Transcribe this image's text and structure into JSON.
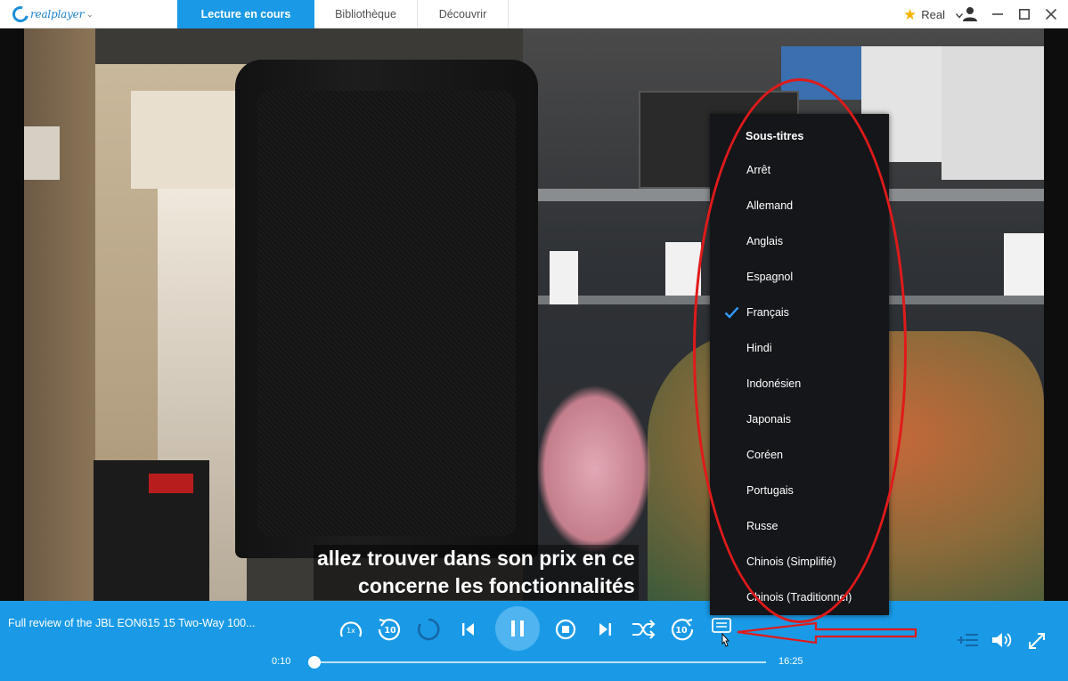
{
  "app": {
    "logo_text": "realplayer",
    "colors": {
      "accent": "#1a9ae6",
      "annotation": "#e01a1a",
      "menu_bg": "#14161a",
      "star": "#f5b400"
    }
  },
  "tabs": [
    {
      "label": "Lecture en cours",
      "active": true
    },
    {
      "label": "Bibliothèque",
      "active": false
    },
    {
      "label": "Découvrir",
      "active": false
    }
  ],
  "titlebar_right": {
    "real_label": "Real",
    "icons": [
      "star-icon",
      "user-icon",
      "chevron-down-icon",
      "minimize-icon",
      "maximize-icon",
      "close-icon"
    ]
  },
  "video": {
    "subtitle_lines": [
      "allez trouver dans son prix en ce",
      "concerne les fonctionnalités"
    ]
  },
  "subtitles_menu": {
    "title": "Sous-titres",
    "items": [
      {
        "label": "Arrêt",
        "selected": false
      },
      {
        "label": "Allemand",
        "selected": false
      },
      {
        "label": "Anglais",
        "selected": false
      },
      {
        "label": "Espagnol",
        "selected": false
      },
      {
        "label": "Français",
        "selected": true
      },
      {
        "label": "Hindi",
        "selected": false
      },
      {
        "label": "Indonésien",
        "selected": false
      },
      {
        "label": "Japonais",
        "selected": false
      },
      {
        "label": "Coréen",
        "selected": false
      },
      {
        "label": "Portugais",
        "selected": false
      },
      {
        "label": "Russe",
        "selected": false
      },
      {
        "label": "Chinois (Simplifié)",
        "selected": false
      },
      {
        "label": "Chinois (Traditionnel)",
        "selected": false
      }
    ]
  },
  "controls": {
    "media_title": "Full review of the JBL EON615 15 Two-Way 100...",
    "speed_label": "1x",
    "skip_back_label": "10",
    "skip_forward_label": "10",
    "elapsed": "0:10",
    "duration": "16:25",
    "progress_fraction": 0.01,
    "icons": [
      "speed-icon",
      "rewind-10-icon",
      "loading-icon",
      "previous-icon",
      "pause-icon",
      "stop-icon",
      "next-icon",
      "shuffle-icon",
      "forward-10-icon",
      "subtitles-icon",
      "add-playlist-icon",
      "volume-icon",
      "fullscreen-icon"
    ]
  }
}
